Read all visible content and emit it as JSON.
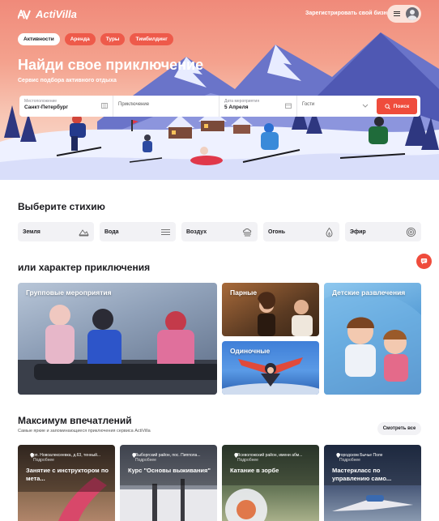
{
  "header": {
    "brand": "ActiVilla",
    "register_link": "Зарегистрировать свой бизнес"
  },
  "tabs": [
    {
      "label": "Активности",
      "active": true
    },
    {
      "label": "Аренда",
      "active": false
    },
    {
      "label": "Туры",
      "active": false
    },
    {
      "label": "Тимбилдинг",
      "active": false
    }
  ],
  "hero": {
    "title": "Найди свое приключение",
    "subtitle": "Сервис подбора активного отдыха"
  },
  "search": {
    "location_label": "Местоположение",
    "location_value": "Санкт-Петербург",
    "adventure_placeholder": "Приключение",
    "date_label": "Дата мероприятия",
    "date_value": "5 Апреля",
    "guests_placeholder": "Гости",
    "button_label": "Поиск"
  },
  "elements_section": {
    "title": "Выберите стихию",
    "items": [
      {
        "label": "Земля",
        "icon": "earth-icon"
      },
      {
        "label": "Вода",
        "icon": "water-icon"
      },
      {
        "label": "Воздух",
        "icon": "air-icon"
      },
      {
        "label": "Огонь",
        "icon": "fire-icon"
      },
      {
        "label": "Эфир",
        "icon": "ether-icon"
      }
    ]
  },
  "character_section": {
    "title": "или характер приключения",
    "cards": [
      {
        "label": "Групповые мероприятия"
      },
      {
        "label": "Парные"
      },
      {
        "label": "Одиночные"
      },
      {
        "label": "Детские развлечения"
      }
    ]
  },
  "impressions_section": {
    "title": "Максимум впечатлений",
    "subtitle": "Самые яркие и запоминающиеся приключения сервиса ActiVilla",
    "see_all": "Смотреть все",
    "more_label": "Подробнее",
    "items": [
      {
        "location": "рп. Новоалексеевка, д.63, тенный...",
        "name": "Занятие с инструктором по мета..."
      },
      {
        "location": "Выборгский район, пос. Пиппола...",
        "name": "Курс \"Основы выживания\""
      },
      {
        "location": "Всеволожский район, имени абм...",
        "name": "Катание в зорбе"
      },
      {
        "location": "городском Бычье Поле",
        "name": "Мастеркласс по управлению само..."
      }
    ]
  },
  "colors": {
    "accent": "#ef4c3c",
    "tab_inactive": "#ee5a4a",
    "element_bg": "#f2f2f5"
  }
}
